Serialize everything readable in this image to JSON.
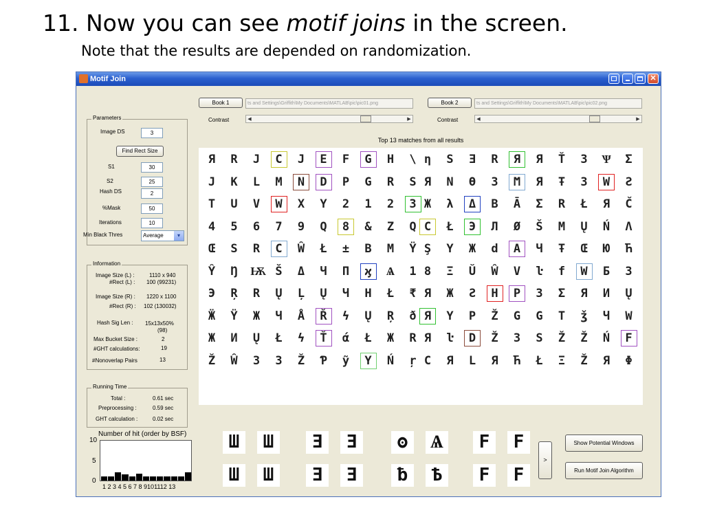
{
  "slide": {
    "title_prefix": "11. Now you can see ",
    "title_emph": "motif joins",
    "title_suffix": " in the screen.",
    "subtitle": "Note that the results are depended on randomization."
  },
  "window": {
    "title": "Motif Join",
    "close_glyph": "✕"
  },
  "parameters": {
    "legend": "Parameters",
    "image_ds_label": "Image DS",
    "image_ds": "3",
    "find_rect_button": "Find Rect Size",
    "s1_label": "S1",
    "s1": "30",
    "s2_label": "S2",
    "s2": "25",
    "hash_ds_label": "Hash DS",
    "hash_ds": "2",
    "mask_label": "%Mask",
    "mask": "50",
    "iterations_label": "Iterations",
    "iterations": "10",
    "min_black_label": "Min Black Thres",
    "min_black": "Average",
    "dropdown_glyph": "▾"
  },
  "information": {
    "legend": "Information",
    "size_l_label": "Image Size (L) :",
    "size_l": "1110 x 940",
    "rect_l_label": "#Rect (L) :",
    "rect_l": "100 (99231)",
    "size_r_label": "Image Size (R) :",
    "size_r": "1220 x 1100",
    "rect_r_label": "#Rect (R) :",
    "rect_r": "102 (130032)",
    "hash_sig_label": "Hash Sig Len :",
    "hash_sig": "15x13x50%",
    "hash_sig_extra": "(98)",
    "max_bucket_label": "Max Bucket Size :",
    "max_bucket": "2",
    "ght_label": "#GHT calculations:",
    "ght": "19",
    "nonoverlap_label": "#Nonoverlap Pairs",
    "nonoverlap": "13"
  },
  "running_time": {
    "legend": "Running Time",
    "total_label": "Total :",
    "total": "0.61 sec",
    "pre_label": "Preprocessing :",
    "pre": "0.59 sec",
    "ght_label": "GHT calculation :",
    "ght": "0.02 sec"
  },
  "histogram": {
    "title": "Number of hit (order by BSF)",
    "y_ticks": [
      "10",
      "5",
      "0"
    ],
    "x_labels": "1 2 3 4 5 6 7 8 9101112 13",
    "values": [
      1,
      1,
      2,
      1.5,
      1,
      1.8,
      1,
      1,
      1,
      1,
      1,
      1,
      2
    ]
  },
  "book1": {
    "button": "Book 1",
    "path": "ts and Settings\\Griffith\\My Documents\\MATLAB\\pic\\pic01.png",
    "contrast_label": "Contrast"
  },
  "book2": {
    "button": "Book 2",
    "path": "ts and Settings\\Griffith\\My Documents\\MATLAB\\pic\\pic02.png",
    "contrast_label": "Contrast"
  },
  "slider_arrows": {
    "left": "◀",
    "right": "▶"
  },
  "results": {
    "caption": "Top 13 matches from all results",
    "left_rows": [
      "ЯRJCJEFGH\\",
      "JKLMNDPGRS",
      "TUVWXY2123",
      "45679Q8&ZQ",
      "ŒSRCŴŁ±BMŸ",
      "ŶŊѬŠΔЧПϗѦ1",
      "ЭŖRŲĻŲЧHŁ₹",
      "ӜŸЖЧÅŘϟŲŖð",
      "ЖИŲŁϟŤάŁЖR",
      "ŽŴЗ3ŽƤỹYŃŗ"
    ],
    "right_rows": [
      "ηSƎRЯЯŤЗѰΣ",
      "ЯNӨЗϺЯŦЗWƧ",
      "ЖλΔBĀΣRŁЯČ",
      "CŁЭЛØŠMŲŃΛ",
      "ŞYЖdAЧŦŒЮЋ",
      "8ΞŬŴVŀfWБЗ",
      "ЯЖƧHPЗΣЯИŲ",
      "ЯΥPŽGGTǯЧW",
      "ЯŀDŽЗSŽŽŃF",
      "CЯLЯЋŁΞŽЯΦ"
    ],
    "thumbs_top": [
      "Ш",
      "Ш",
      "Ǝ",
      "Ǝ",
      "ʘ",
      "Ѧ",
      "F",
      "F"
    ],
    "thumbs_bottom": [
      "Ш",
      "Ш",
      "Ǝ",
      "Ǝ",
      "ƀ",
      "Ѣ",
      "F",
      "F"
    ]
  },
  "actions": {
    "next_button": ">",
    "show_windows_button": "Show Potential Windows",
    "run_button": "Run Motif Join Algorithm"
  },
  "colors": {
    "box_yellow": "#c8c830",
    "box_purple": "#a050c0",
    "box_red": "#e02020",
    "box_brown": "#8a4a3a",
    "box_green": "#30c030",
    "box_lightgreen": "#70d070",
    "box_blue": "#2040c0",
    "box_lightblue": "#80a8d0",
    "box_teal": "#40a0a0"
  }
}
